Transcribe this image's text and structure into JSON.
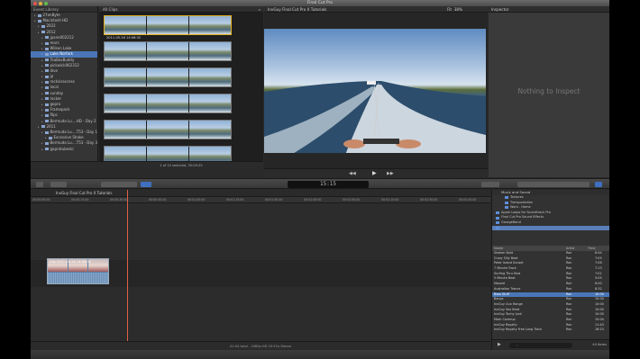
{
  "window": {
    "title": "Final Cut Pro"
  },
  "library": {
    "header": "Event Library",
    "items": [
      {
        "label": "27onByte",
        "indent": 1,
        "sel": false
      },
      {
        "label": "Macintosh HD",
        "indent": 1,
        "sel": false
      },
      {
        "label": "2022",
        "indent": 2,
        "sel": false
      },
      {
        "label": "2012",
        "indent": 2,
        "sel": false
      },
      {
        "label": "jpane002212",
        "indent": 3,
        "sel": false
      },
      {
        "label": "mars",
        "indent": 3,
        "sel": false
      },
      {
        "label": "Wilson Lake",
        "indent": 3,
        "sel": false
      },
      {
        "label": "Lake Norfork",
        "indent": 3,
        "sel": true
      },
      {
        "label": "TeaBoxBuddy",
        "indent": 3,
        "sel": false
      },
      {
        "label": "pickwick062312",
        "indent": 3,
        "sel": false
      },
      {
        "label": "dive",
        "indent": 3,
        "sel": false
      },
      {
        "label": "jp",
        "indent": 3,
        "sel": false
      },
      {
        "label": "rocksisaccess",
        "indent": 3,
        "sel": false
      },
      {
        "label": "local",
        "indent": 3,
        "sel": false
      },
      {
        "label": "sunday",
        "indent": 3,
        "sel": false
      },
      {
        "label": "rocker",
        "indent": 3,
        "sel": false
      },
      {
        "label": "gopro",
        "indent": 3,
        "sel": false
      },
      {
        "label": "Framepack",
        "indent": 3,
        "sel": false
      },
      {
        "label": "filpc",
        "indent": 3,
        "sel": false
      },
      {
        "label": "Bermuda Lu....HD - Day 2",
        "indent": 3,
        "sel": false
      },
      {
        "label": "2011",
        "indent": 2,
        "sel": false
      },
      {
        "label": "Bermuda Lu....T53 - Day 1",
        "indent": 3,
        "sel": false
      },
      {
        "label": "Excessive Shake",
        "indent": 4,
        "sel": false
      },
      {
        "label": "Bermuda Lu....T53 - Day 3",
        "indent": 3,
        "sel": false
      },
      {
        "label": "goprotubeski",
        "indent": 3,
        "sel": false
      }
    ]
  },
  "browser": {
    "header": "All Clips",
    "first_time": "2011-05-16 14:06:32",
    "footer": "1 of 10 selected, 35:09:25"
  },
  "viewer": {
    "header": "InvGuy Final Cut Pro X Tutorials",
    "fit": "Fit",
    "zoom": "38%"
  },
  "inspector": {
    "header": "Inspector",
    "empty_text": "Nothing to Inspect"
  },
  "toolbar": {
    "timecode": "15:15"
  },
  "timeline": {
    "project_name": "InvGuy Final Cut Pro X Tutorials",
    "ruler": [
      "00:00:00:00",
      "00:00:15:00",
      "00:00:30:00",
      "00:00:45:00",
      "00:01:00:00",
      "00:01:15:00",
      "00:01:30:00",
      "00:01:45:00",
      "00:02:00:00",
      "00:02:15:00",
      "00:02:30:00",
      "00:02:45:00"
    ],
    "clip_label": "Clip 2011-05-16 14:06:32",
    "footer": "01:04 total - 1080p HD 29.97p Stereo"
  },
  "music": {
    "header": "Music and Sound",
    "sources": [
      {
        "label": "Textures",
        "sel": false
      },
      {
        "label": "Transportation",
        "sel": false
      },
      {
        "label": "Work - Home",
        "sel": false
      },
      {
        "label": "Apple Loops for Soundtrack Pro",
        "sel": false
      },
      {
        "label": "Final Cut Pro Sound Effects",
        "sel": false
      },
      {
        "label": "GarageBand",
        "sel": false
      },
      {
        "label": "",
        "sel": true
      }
    ],
    "columns": {
      "name": "Name",
      "artist": "Artist",
      "time": "Time"
    },
    "songs": [
      {
        "name": "Shaken Bold",
        "artist": "Ron",
        "time": "8:44",
        "sel": false
      },
      {
        "name": "Crazy Silly Beat",
        "artist": "Ron",
        "time": "7:05",
        "sel": false
      },
      {
        "name": "Peter Island Sunset",
        "artist": "Ron",
        "time": "7:06",
        "sel": false
      },
      {
        "name": "7 Minute Track",
        "artist": "Ron",
        "time": "7:13",
        "sel": false
      },
      {
        "name": "Surfing Thru Mud",
        "artist": "Ron",
        "time": "7:01",
        "sel": false
      },
      {
        "name": "5 Minute Beat",
        "artist": "Ron",
        "time": "5:05",
        "sel": false
      },
      {
        "name": "Mosaid",
        "artist": "Ron",
        "time": "6:00",
        "sel": false
      },
      {
        "name": "Australian Trance",
        "artist": "Ron",
        "time": "8:32",
        "sel": false
      },
      {
        "name": "Bass Stuff",
        "artist": "Ron",
        "time": "10:00",
        "sel": true
      },
      {
        "name": "Bangs",
        "artist": "Ron",
        "time": "10:00",
        "sel": false
      },
      {
        "name": "InvGuy Gun Range",
        "artist": "Ron",
        "time": "10:00",
        "sel": false
      },
      {
        "name": "InvGuy Sex Beat",
        "artist": "Ron",
        "time": "10:00",
        "sel": false
      },
      {
        "name": "InvGuy Techy Junk",
        "artist": "Ron",
        "time": "10:00",
        "sel": false
      },
      {
        "name": "Mark Coverup",
        "artist": "Ron",
        "time": "10:04",
        "sel": false
      },
      {
        "name": "InvGuy Royalty",
        "artist": "Ron",
        "time": "11:43",
        "sel": false
      },
      {
        "name": "InvGuy Royalty Free Long Track",
        "artist": "Ron",
        "time": "18:23",
        "sel": false
      }
    ],
    "count": "44 items"
  }
}
